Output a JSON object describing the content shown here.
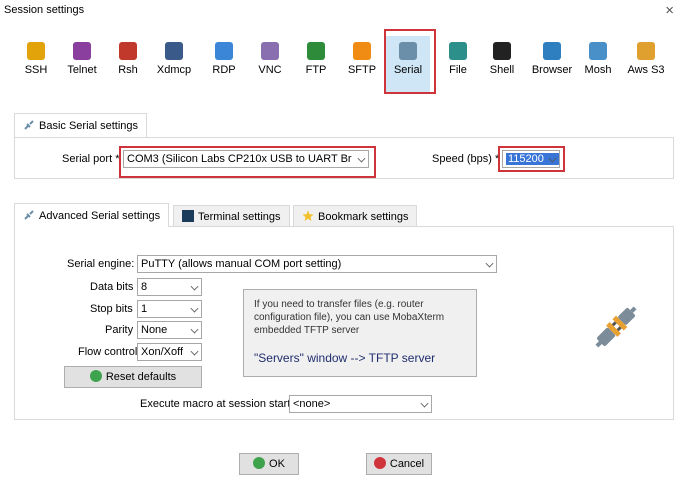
{
  "window": {
    "title": "Session settings",
    "close": "×"
  },
  "protocols": [
    {
      "label": "SSH",
      "icon": "ssh-icon",
      "color": "#e2a20a"
    },
    {
      "label": "Telnet",
      "icon": "telnet-icon",
      "color": "#8a3e9d"
    },
    {
      "label": "Rsh",
      "icon": "rsh-icon",
      "color": "#c0392b"
    },
    {
      "label": "Xdmcp",
      "icon": "xdmcp-icon",
      "color": "#3a5a8a"
    },
    {
      "label": "RDP",
      "icon": "rdp-icon",
      "color": "#3b86d6"
    },
    {
      "label": "VNC",
      "icon": "vnc-icon",
      "color": "#8a6fb0"
    },
    {
      "label": "FTP",
      "icon": "ftp-icon",
      "color": "#2e8b3a"
    },
    {
      "label": "SFTP",
      "icon": "sftp-icon",
      "color": "#f08c14"
    },
    {
      "label": "Serial",
      "icon": "serial-plug-icon",
      "color": "#6b8fa8"
    },
    {
      "label": "File",
      "icon": "file-icon",
      "color": "#2c8f8a"
    },
    {
      "label": "Shell",
      "icon": "shell-icon",
      "color": "#222222"
    },
    {
      "label": "Browser",
      "icon": "browser-globe-icon",
      "color": "#2d7fbf"
    },
    {
      "label": "Mosh",
      "icon": "mosh-icon",
      "color": "#4a90c8"
    },
    {
      "label": "Aws S3",
      "icon": "aws-s3-icon",
      "color": "#e0a030"
    }
  ],
  "selected_protocol": "Serial",
  "basic": {
    "tab": "Basic Serial settings",
    "serial_port_label": "Serial port *",
    "serial_port_value": "COM3  (Silicon Labs CP210x USB to UART Br",
    "speed_label": "Speed (bps) *",
    "speed_value": "115200"
  },
  "tabs": {
    "advanced": "Advanced Serial settings",
    "terminal": "Terminal settings",
    "bookmark": "Bookmark settings"
  },
  "advanced": {
    "engine_label": "Serial engine:",
    "engine_value": "PuTTY   (allows manual COM port setting)",
    "data_bits_label": "Data bits",
    "data_bits_value": "8",
    "stop_bits_label": "Stop bits",
    "stop_bits_value": "1",
    "parity_label": "Parity",
    "parity_value": "None",
    "flow_label": "Flow control",
    "flow_value": "Xon/Xoff",
    "reset_label": "Reset defaults",
    "macro_label": "Execute macro at session start:",
    "macro_value": "<none>"
  },
  "info": {
    "text": "If you need to transfer files (e.g. router configuration file), you can use MobaXterm embedded TFTP server",
    "link": "\"Servers\" window  -->  TFTP server"
  },
  "buttons": {
    "ok": "OK",
    "cancel": "Cancel"
  },
  "colors": {
    "highlight": "#d0343b",
    "selection": "#3875d7",
    "ok_icon": "#3fa34d",
    "cancel_icon": "#d0343b"
  }
}
